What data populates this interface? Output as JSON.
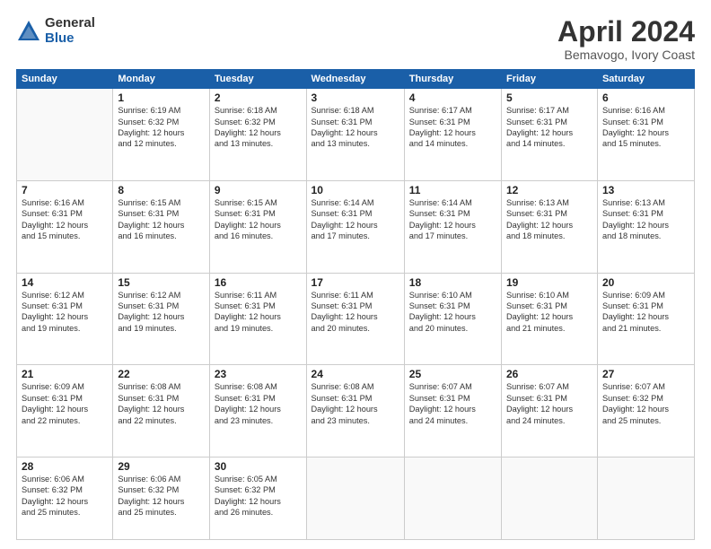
{
  "logo": {
    "general": "General",
    "blue": "Blue"
  },
  "title": "April 2024",
  "subtitle": "Bemavogo, Ivory Coast",
  "days_header": [
    "Sunday",
    "Monday",
    "Tuesday",
    "Wednesday",
    "Thursday",
    "Friday",
    "Saturday"
  ],
  "weeks": [
    [
      {
        "num": "",
        "info": ""
      },
      {
        "num": "1",
        "info": "Sunrise: 6:19 AM\nSunset: 6:32 PM\nDaylight: 12 hours\nand 12 minutes."
      },
      {
        "num": "2",
        "info": "Sunrise: 6:18 AM\nSunset: 6:32 PM\nDaylight: 12 hours\nand 13 minutes."
      },
      {
        "num": "3",
        "info": "Sunrise: 6:18 AM\nSunset: 6:31 PM\nDaylight: 12 hours\nand 13 minutes."
      },
      {
        "num": "4",
        "info": "Sunrise: 6:17 AM\nSunset: 6:31 PM\nDaylight: 12 hours\nand 14 minutes."
      },
      {
        "num": "5",
        "info": "Sunrise: 6:17 AM\nSunset: 6:31 PM\nDaylight: 12 hours\nand 14 minutes."
      },
      {
        "num": "6",
        "info": "Sunrise: 6:16 AM\nSunset: 6:31 PM\nDaylight: 12 hours\nand 15 minutes."
      }
    ],
    [
      {
        "num": "7",
        "info": "Sunrise: 6:16 AM\nSunset: 6:31 PM\nDaylight: 12 hours\nand 15 minutes."
      },
      {
        "num": "8",
        "info": "Sunrise: 6:15 AM\nSunset: 6:31 PM\nDaylight: 12 hours\nand 16 minutes."
      },
      {
        "num": "9",
        "info": "Sunrise: 6:15 AM\nSunset: 6:31 PM\nDaylight: 12 hours\nand 16 minutes."
      },
      {
        "num": "10",
        "info": "Sunrise: 6:14 AM\nSunset: 6:31 PM\nDaylight: 12 hours\nand 17 minutes."
      },
      {
        "num": "11",
        "info": "Sunrise: 6:14 AM\nSunset: 6:31 PM\nDaylight: 12 hours\nand 17 minutes."
      },
      {
        "num": "12",
        "info": "Sunrise: 6:13 AM\nSunset: 6:31 PM\nDaylight: 12 hours\nand 18 minutes."
      },
      {
        "num": "13",
        "info": "Sunrise: 6:13 AM\nSunset: 6:31 PM\nDaylight: 12 hours\nand 18 minutes."
      }
    ],
    [
      {
        "num": "14",
        "info": "Sunrise: 6:12 AM\nSunset: 6:31 PM\nDaylight: 12 hours\nand 19 minutes."
      },
      {
        "num": "15",
        "info": "Sunrise: 6:12 AM\nSunset: 6:31 PM\nDaylight: 12 hours\nand 19 minutes."
      },
      {
        "num": "16",
        "info": "Sunrise: 6:11 AM\nSunset: 6:31 PM\nDaylight: 12 hours\nand 19 minutes."
      },
      {
        "num": "17",
        "info": "Sunrise: 6:11 AM\nSunset: 6:31 PM\nDaylight: 12 hours\nand 20 minutes."
      },
      {
        "num": "18",
        "info": "Sunrise: 6:10 AM\nSunset: 6:31 PM\nDaylight: 12 hours\nand 20 minutes."
      },
      {
        "num": "19",
        "info": "Sunrise: 6:10 AM\nSunset: 6:31 PM\nDaylight: 12 hours\nand 21 minutes."
      },
      {
        "num": "20",
        "info": "Sunrise: 6:09 AM\nSunset: 6:31 PM\nDaylight: 12 hours\nand 21 minutes."
      }
    ],
    [
      {
        "num": "21",
        "info": "Sunrise: 6:09 AM\nSunset: 6:31 PM\nDaylight: 12 hours\nand 22 minutes."
      },
      {
        "num": "22",
        "info": "Sunrise: 6:08 AM\nSunset: 6:31 PM\nDaylight: 12 hours\nand 22 minutes."
      },
      {
        "num": "23",
        "info": "Sunrise: 6:08 AM\nSunset: 6:31 PM\nDaylight: 12 hours\nand 23 minutes."
      },
      {
        "num": "24",
        "info": "Sunrise: 6:08 AM\nSunset: 6:31 PM\nDaylight: 12 hours\nand 23 minutes."
      },
      {
        "num": "25",
        "info": "Sunrise: 6:07 AM\nSunset: 6:31 PM\nDaylight: 12 hours\nand 24 minutes."
      },
      {
        "num": "26",
        "info": "Sunrise: 6:07 AM\nSunset: 6:31 PM\nDaylight: 12 hours\nand 24 minutes."
      },
      {
        "num": "27",
        "info": "Sunrise: 6:07 AM\nSunset: 6:32 PM\nDaylight: 12 hours\nand 25 minutes."
      }
    ],
    [
      {
        "num": "28",
        "info": "Sunrise: 6:06 AM\nSunset: 6:32 PM\nDaylight: 12 hours\nand 25 minutes."
      },
      {
        "num": "29",
        "info": "Sunrise: 6:06 AM\nSunset: 6:32 PM\nDaylight: 12 hours\nand 25 minutes."
      },
      {
        "num": "30",
        "info": "Sunrise: 6:05 AM\nSunset: 6:32 PM\nDaylight: 12 hours\nand 26 minutes."
      },
      {
        "num": "",
        "info": ""
      },
      {
        "num": "",
        "info": ""
      },
      {
        "num": "",
        "info": ""
      },
      {
        "num": "",
        "info": ""
      }
    ]
  ]
}
